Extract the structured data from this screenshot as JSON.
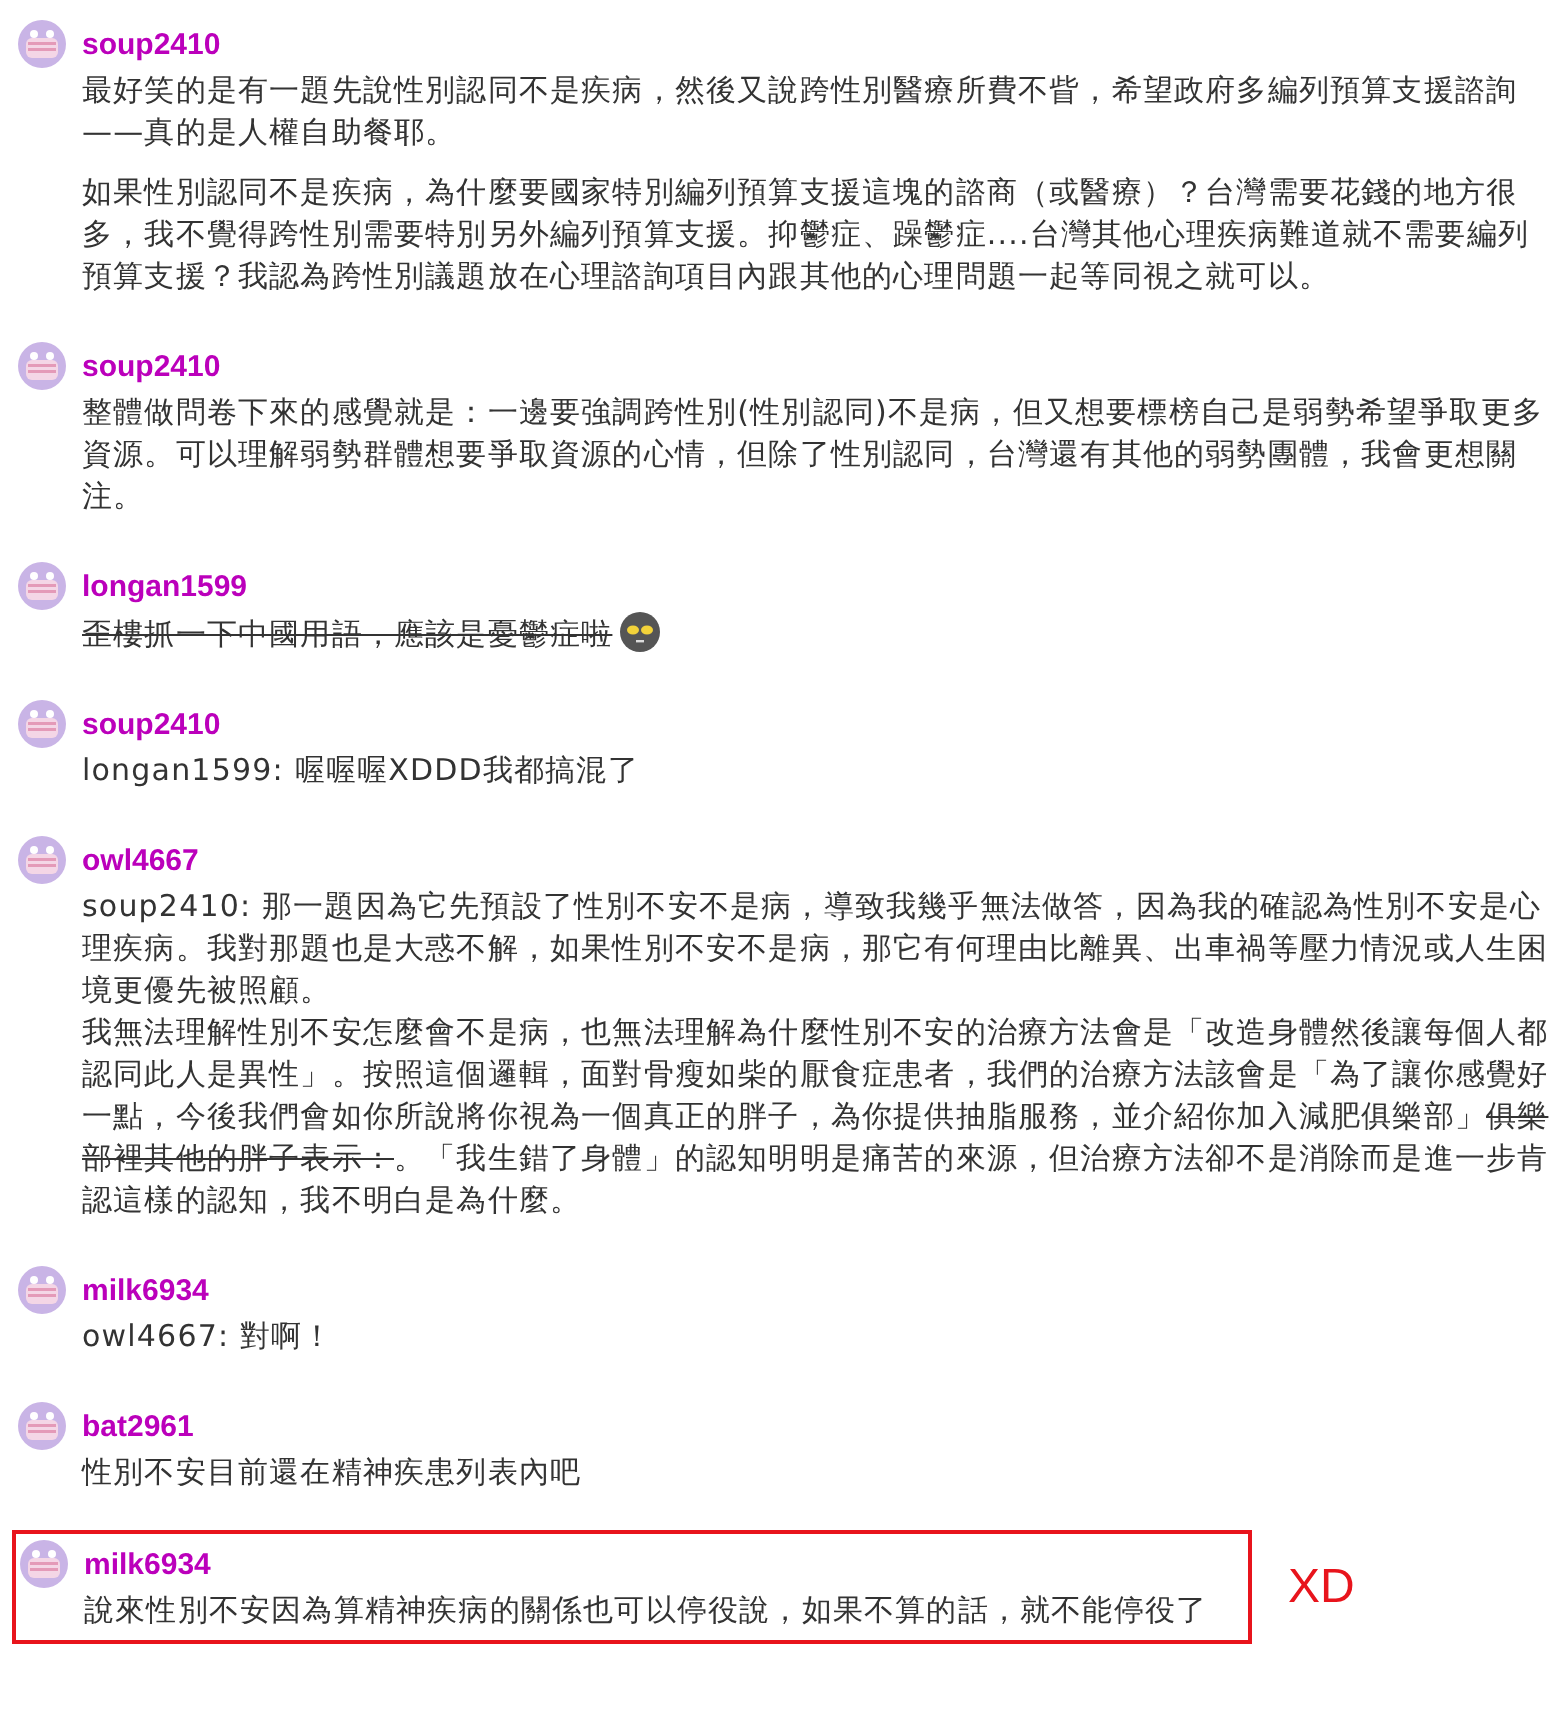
{
  "comments": [
    {
      "user": "soup2410",
      "highlighted": false,
      "paragraphs": [
        [
          [
            {
              "kind": "text",
              "text": "最好笑的是有一題先說性別認同不是疾病，然後又說跨性別醫療所費不眥，希望政府多編列預算支援諮詢——真的是人權自助餐耶。"
            }
          ]
        ],
        [
          [
            {
              "kind": "text",
              "text": "如果性別認同不是疾病，為什麼要國家特別編列預算支援這塊的諮商（或醫療）？台灣需要花錢的地方很多，我不覺得跨性別需要特別另外編列預算支援。抑鬱症、躁鬱症....台灣其他心理疾病難道就不需要編列預算支援？我認為跨性別議題放在心理諮詢項目內跟其他的心理問題一起等同視之就可以。"
            }
          ]
        ]
      ]
    },
    {
      "user": "soup2410",
      "highlighted": false,
      "paragraphs": [
        [
          [
            {
              "kind": "text",
              "text": "整體做問卷下來的感覺就是：一邊要強調跨性別(性別認同)不是病，但又想要標榜自己是弱勢希望爭取更多資源。可以理解弱勢群體想要爭取資源的心情，但除了性別認同，台灣還有其他的弱勢團體，我會更想關注。"
            }
          ]
        ]
      ]
    },
    {
      "user": "longan1599",
      "highlighted": false,
      "paragraphs": [
        [
          [
            {
              "kind": "struck",
              "text": "歪樓抓一下中國用語，應該是憂鬱症啦"
            },
            {
              "kind": "emoji"
            }
          ]
        ]
      ]
    },
    {
      "user": "soup2410",
      "highlighted": false,
      "paragraphs": [
        [
          [
            {
              "kind": "text",
              "text": "longan1599: 喔喔喔XDDD我都搞混了"
            }
          ]
        ]
      ]
    },
    {
      "user": "owl4667",
      "highlighted": false,
      "paragraphs": [
        [
          [
            {
              "kind": "text",
              "text": "soup2410: 那一題因為它先預設了性別不安不是病，導致我幾乎無法做答，因為我的確認為性別不安是心理疾病。我對那題也是大惑不解，如果性別不安不是病，那它有何理由比離異、出車禍等壓力情況或人生困境更優先被照顧。"
            }
          ],
          [
            {
              "kind": "text",
              "text": "我無法理解性別不安怎麼會不是病，也無法理解為什麼性別不安的治療方法會是「改造身體然後讓每個人都認同此人是異性」。按照這個邏輯，面對骨瘦如柴的厭食症患者，我們的治療方法該會是「為了讓你感覺好一點，今後我們會如你所說將你視為一個真正的胖子，為你提供抽脂服務，並介紹你加入減肥俱樂部」"
            },
            {
              "kind": "struck",
              "text": "俱樂部裡其他的胖子表示："
            },
            {
              "kind": "text",
              "text": "。「我生錯了身體」的認知明明是痛苦的來源，但治療方法卻不是消除而是進一步肯認這樣的認知，我不明白是為什麼。"
            }
          ]
        ]
      ]
    },
    {
      "user": "milk6934",
      "highlighted": false,
      "paragraphs": [
        [
          [
            {
              "kind": "text",
              "text": "owl4667: 對啊！"
            }
          ]
        ]
      ]
    },
    {
      "user": "bat2961",
      "highlighted": false,
      "paragraphs": [
        [
          [
            {
              "kind": "text",
              "text": "性別不安目前還在精神疾患列表內吧"
            }
          ]
        ]
      ]
    },
    {
      "user": "milk6934",
      "highlighted": true,
      "note": "XD",
      "paragraphs": [
        [
          [
            {
              "kind": "text",
              "text": "說來性別不安因為算精神疾病的關係也可以停役說，如果不算的話，就不能停役了"
            }
          ]
        ]
      ]
    }
  ]
}
